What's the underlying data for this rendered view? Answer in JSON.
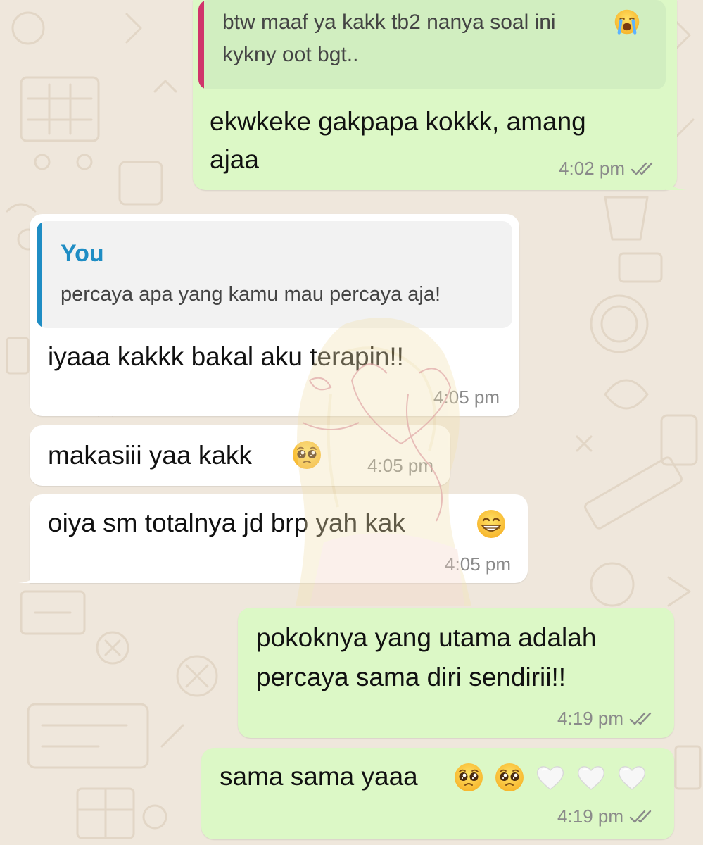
{
  "theme": {
    "wallpaper": "#efe7dc",
    "outgoing_bubble": "#dcf8c6",
    "incoming_bubble": "#ffffff",
    "quote_out_bg": "#d1eec0",
    "quote_in_bg": "#f2f2f2",
    "quote_bar_pink": "#d0346b",
    "quote_bar_blue": "#1f8dc4",
    "author_blue": "#1f8dc4",
    "timestamp_color": "#8a8a8a"
  },
  "messages": [
    {
      "direction": "outgoing",
      "quote_text_lines": [
        "btw maaf ya kakk tb2 nanya soal ini",
        "kykny oot bgt.."
      ],
      "quote_icons": [
        "loudly-crying-face-emoji"
      ],
      "text_lines": [
        "ekwkeke gakpapa kokkk, amang",
        "ajaa"
      ],
      "time": "4:02 pm",
      "status": "read-double-check"
    },
    {
      "direction": "incoming",
      "quote_author": "You",
      "quote_text": "percaya apa yang kamu mau percaya aja!",
      "text": "iyaaa kakkk bakal aku terapin!!",
      "time": "4:05 pm"
    },
    {
      "direction": "incoming",
      "text": "makasiii yaa kakk",
      "icons": [
        "pleading-face-emoji"
      ],
      "time": "4:05 pm"
    },
    {
      "direction": "incoming",
      "text": "oiya sm totalnya jd brp yah kak",
      "icons": [
        "grinning-face-emoji"
      ],
      "time": "4:05 pm"
    },
    {
      "direction": "outgoing",
      "text_lines": [
        "pokoknya yang utama adalah",
        "percaya sama diri sendirii!!"
      ],
      "time": "4:19 pm",
      "status": "read-double-check"
    },
    {
      "direction": "outgoing",
      "text": "sama sama yaaa",
      "icons": [
        "pleading-face-emoji",
        "pleading-face-emoji",
        "white-heart-emoji",
        "white-heart-emoji",
        "white-heart-emoji"
      ],
      "time": "4:19 pm",
      "status": "read-double-check"
    }
  ]
}
